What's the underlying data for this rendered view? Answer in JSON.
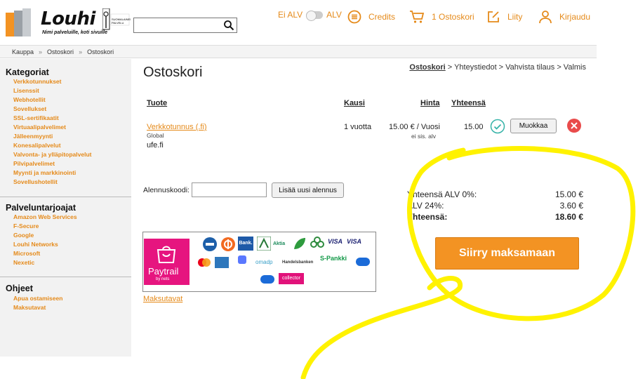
{
  "header": {
    "logo_text": "Louhi",
    "logo_sub": "Nimi palveluille, koti sivuille",
    "search_placeholder": "",
    "vat_off": "Ei ALV",
    "vat_on": "ALV",
    "credits": "Credits",
    "cart": "1 Ostoskori",
    "join": "Liity",
    "login": "Kirjaudu"
  },
  "breadcrumb": [
    "Kauppa",
    "Ostoskori",
    "Ostoskori"
  ],
  "sidebar": {
    "categories_title": "Kategoriat",
    "categories": [
      "Verkkotunnukset",
      "Lisenssit",
      "Webhotellit",
      "Sovellukset",
      "SSL-sertifikaatit",
      "Virtuaalipalvelimet",
      "Jälleenmyynti",
      "Konesalipalvelut",
      "Valvonta- ja ylläpitopalvelut",
      "Pilvipalvelimet",
      "Myynti ja markkinointi",
      "Sovellushotellit"
    ],
    "providers_title": "Palveluntarjoajat",
    "providers": [
      "Amazon Web Services",
      "F-Secure",
      "Google",
      "Louhi Networks",
      "Microsoft",
      "Nexetic"
    ],
    "guides_title": "Ohjeet",
    "guides": [
      "Apua ostamiseen",
      "Maksutavat"
    ]
  },
  "main": {
    "title": "Ostoskori",
    "steps": {
      "current": "Ostoskori",
      "rest": " > Yhteystiedot > Vahvista tilaus > Valmis"
    },
    "table_headers": {
      "product": "Tuote",
      "period": "Kausi",
      "price": "Hinta",
      "total": "Yhteensä"
    },
    "item": {
      "name": "Verkkotunnus (.fi)",
      "scope": "Global",
      "domain": "ufe.fi",
      "period": "1 vuotta",
      "price": "15.00 € / Vuosi",
      "price_note": "ei sis. alv",
      "total": "15.00",
      "edit_label": "Muokkaa"
    },
    "discount_label": "Alennuskoodi:",
    "discount_value": "",
    "discount_button": "Lisää uusi alennus",
    "totals": [
      {
        "label": "Yhteensä ALV 0%:",
        "value": "15.00 €"
      },
      {
        "label": "ALV 24%:",
        "value": "3.60 €"
      },
      {
        "label": "Yhteensä:",
        "value": "18.60 €"
      }
    ],
    "checkout_label": "Siirry maksamaan",
    "payment_methods_link": "Maksutavat",
    "paytrail": {
      "name": "Paytrail",
      "by": "by nets"
    },
    "banks": [
      "Bank.",
      "Aktia",
      "VISA",
      "VISA",
      "S-Pankki",
      "Handelsbanken",
      "omadp",
      "collector"
    ]
  },
  "colors": {
    "accent": "#e58a1a",
    "button": "#f39323",
    "paytrail": "#e6157f",
    "highlight": "#fff200"
  }
}
